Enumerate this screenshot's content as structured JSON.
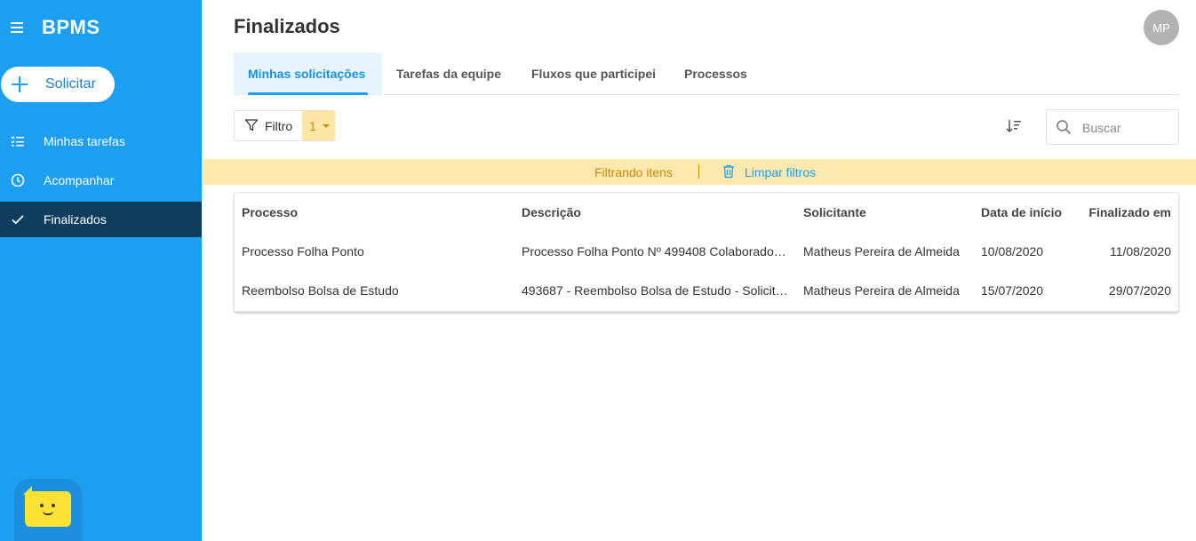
{
  "sidebar": {
    "brand": "BPMS",
    "solicitar_label": "Solicitar",
    "items": [
      {
        "label": "Minhas tarefas",
        "icon": "checklist-icon",
        "active": false
      },
      {
        "label": "Acompanhar",
        "icon": "clock-icon",
        "active": false
      },
      {
        "label": "Finalizados",
        "icon": "check-icon",
        "active": true
      }
    ],
    "accent_color": "#1c9ff1",
    "active_color": "#0f3d5e"
  },
  "header": {
    "title": "Finalizados",
    "avatar_initials": "MP"
  },
  "tabs": [
    {
      "label": "Minhas solicitações",
      "active": true
    },
    {
      "label": "Tarefas da equipe",
      "active": false
    },
    {
      "label": "Fluxos que participei",
      "active": false
    },
    {
      "label": "Processos",
      "active": false
    }
  ],
  "toolbar": {
    "filter_label": "Filtro",
    "filter_count": "1",
    "search_placeholder": "Buscar"
  },
  "filter_bar": {
    "text": "Filtrando itens",
    "clear_label": "Limpar filtros"
  },
  "table": {
    "columns": [
      "Processo",
      "Descrição",
      "Solicitante",
      "Data de início",
      "Finalizado em"
    ],
    "rows": [
      [
        "Processo Folha Ponto",
        "Processo Folha Ponto Nº 499408 Colaborador:...",
        "Matheus Pereira de Almeida",
        "10/08/2020",
        "11/08/2020"
      ],
      [
        "Reembolso Bolsa de Estudo",
        "493687 - Reembolso Bolsa de Estudo - Solicita...",
        "Matheus Pereira de Almeida",
        "15/07/2020",
        "29/07/2020"
      ]
    ]
  }
}
